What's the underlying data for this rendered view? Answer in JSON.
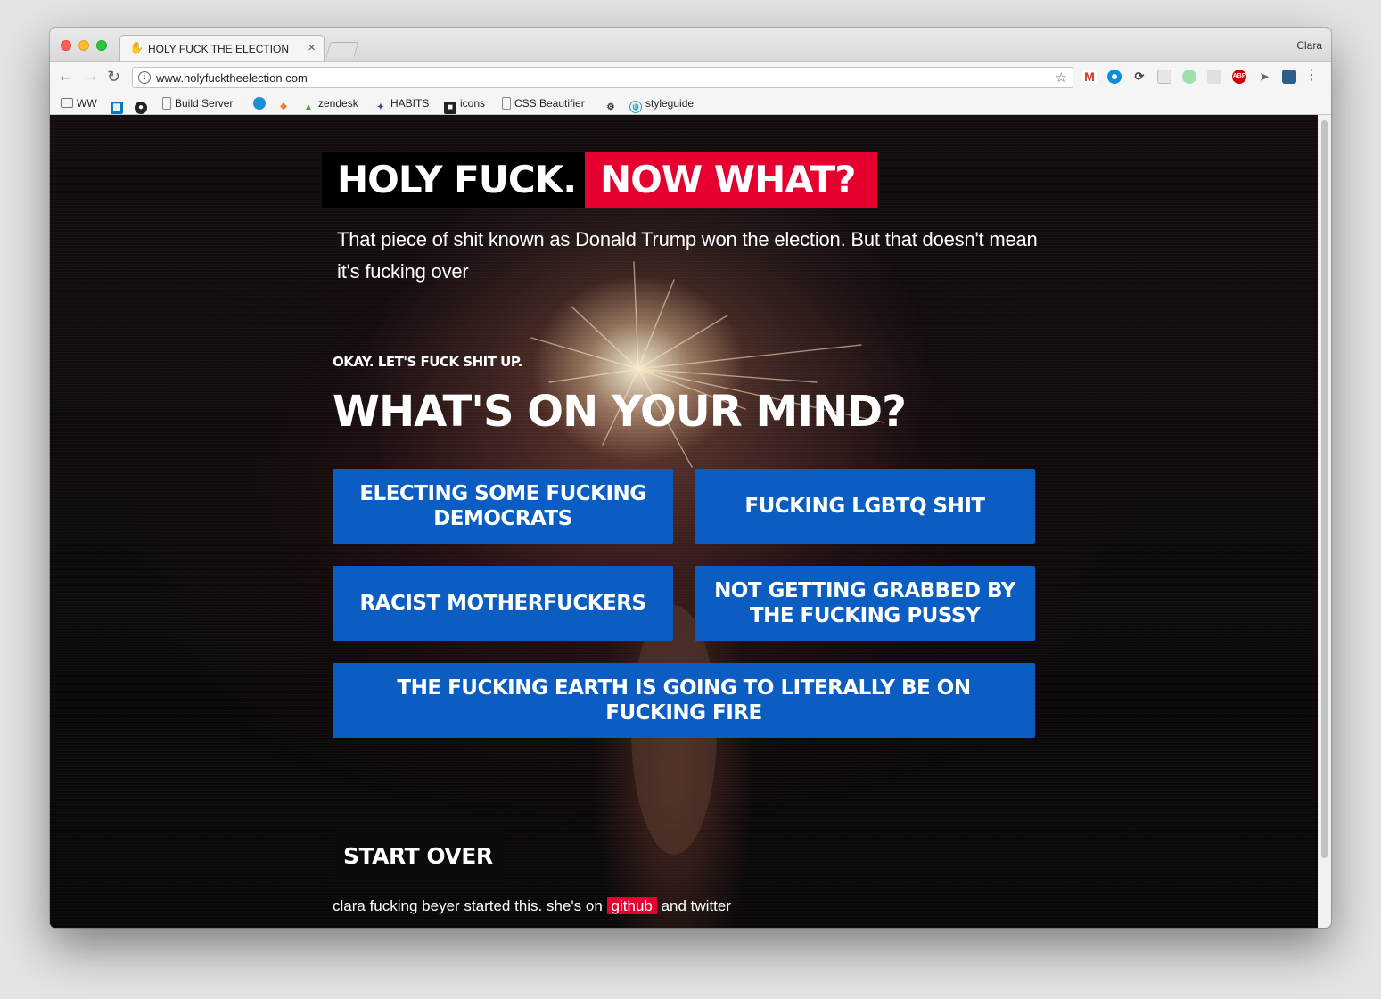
{
  "browser": {
    "tab_title": "HOLY FUCK THE ELECTION",
    "profile_name": "Clara",
    "url": "www.holyfucktheelection.com",
    "bookmarks": [
      {
        "label": "WW",
        "icon": "folder-icon"
      },
      {
        "label": "",
        "icon": "trello-icon"
      },
      {
        "label": "",
        "icon": "github-icon"
      },
      {
        "label": "Build Server",
        "icon": "page-icon"
      },
      {
        "label": "",
        "icon": "circle-icon"
      },
      {
        "label": "",
        "icon": "hubspot-icon"
      },
      {
        "label": "zendesk",
        "icon": "zendesk-icon"
      },
      {
        "label": "HABITS",
        "icon": "habits-icon"
      },
      {
        "label": "icons",
        "icon": "icons-icon"
      },
      {
        "label": "CSS Beautifier",
        "icon": "page-icon"
      },
      {
        "label": "",
        "icon": "robot-icon"
      },
      {
        "label": "styleguide",
        "icon": "styleguide-icon"
      }
    ],
    "extensions": [
      "gmail-icon",
      "circle-icon",
      "sync-icon",
      "bookmark-icon",
      "color-icon",
      "grid-icon",
      "adblock-icon",
      "send-icon",
      "folder-icon"
    ]
  },
  "page": {
    "title_part1": "HOLY FUCK.",
    "title_part2": "NOW WHAT?",
    "intro": "That piece of shit known as Donald Trump won the election. But that doesn't mean it's fucking over",
    "kicker": "OKAY. LET'S FUCK SHIT UP.",
    "question": "WHAT'S ON YOUR MIND?",
    "choices": [
      "ELECTING SOME FUCKING DEMOCRATS",
      "FUCKING LGBTQ SHIT",
      "RACIST MOTHERFUCKERS",
      "NOT GETTING GRABBED BY THE FUCKING PUSSY",
      "THE FUCKING EARTH IS GOING TO LITERALLY BE ON FUCKING FIRE"
    ],
    "start_over": "START OVER",
    "footer_text": "clara fucking beyer started this. she's on",
    "footer_link_github": "github",
    "footer_and": "and twitter"
  },
  "colors": {
    "accent_red": "#e6002f",
    "button_blue": "#0b5dc2",
    "title_black": "#000000"
  }
}
